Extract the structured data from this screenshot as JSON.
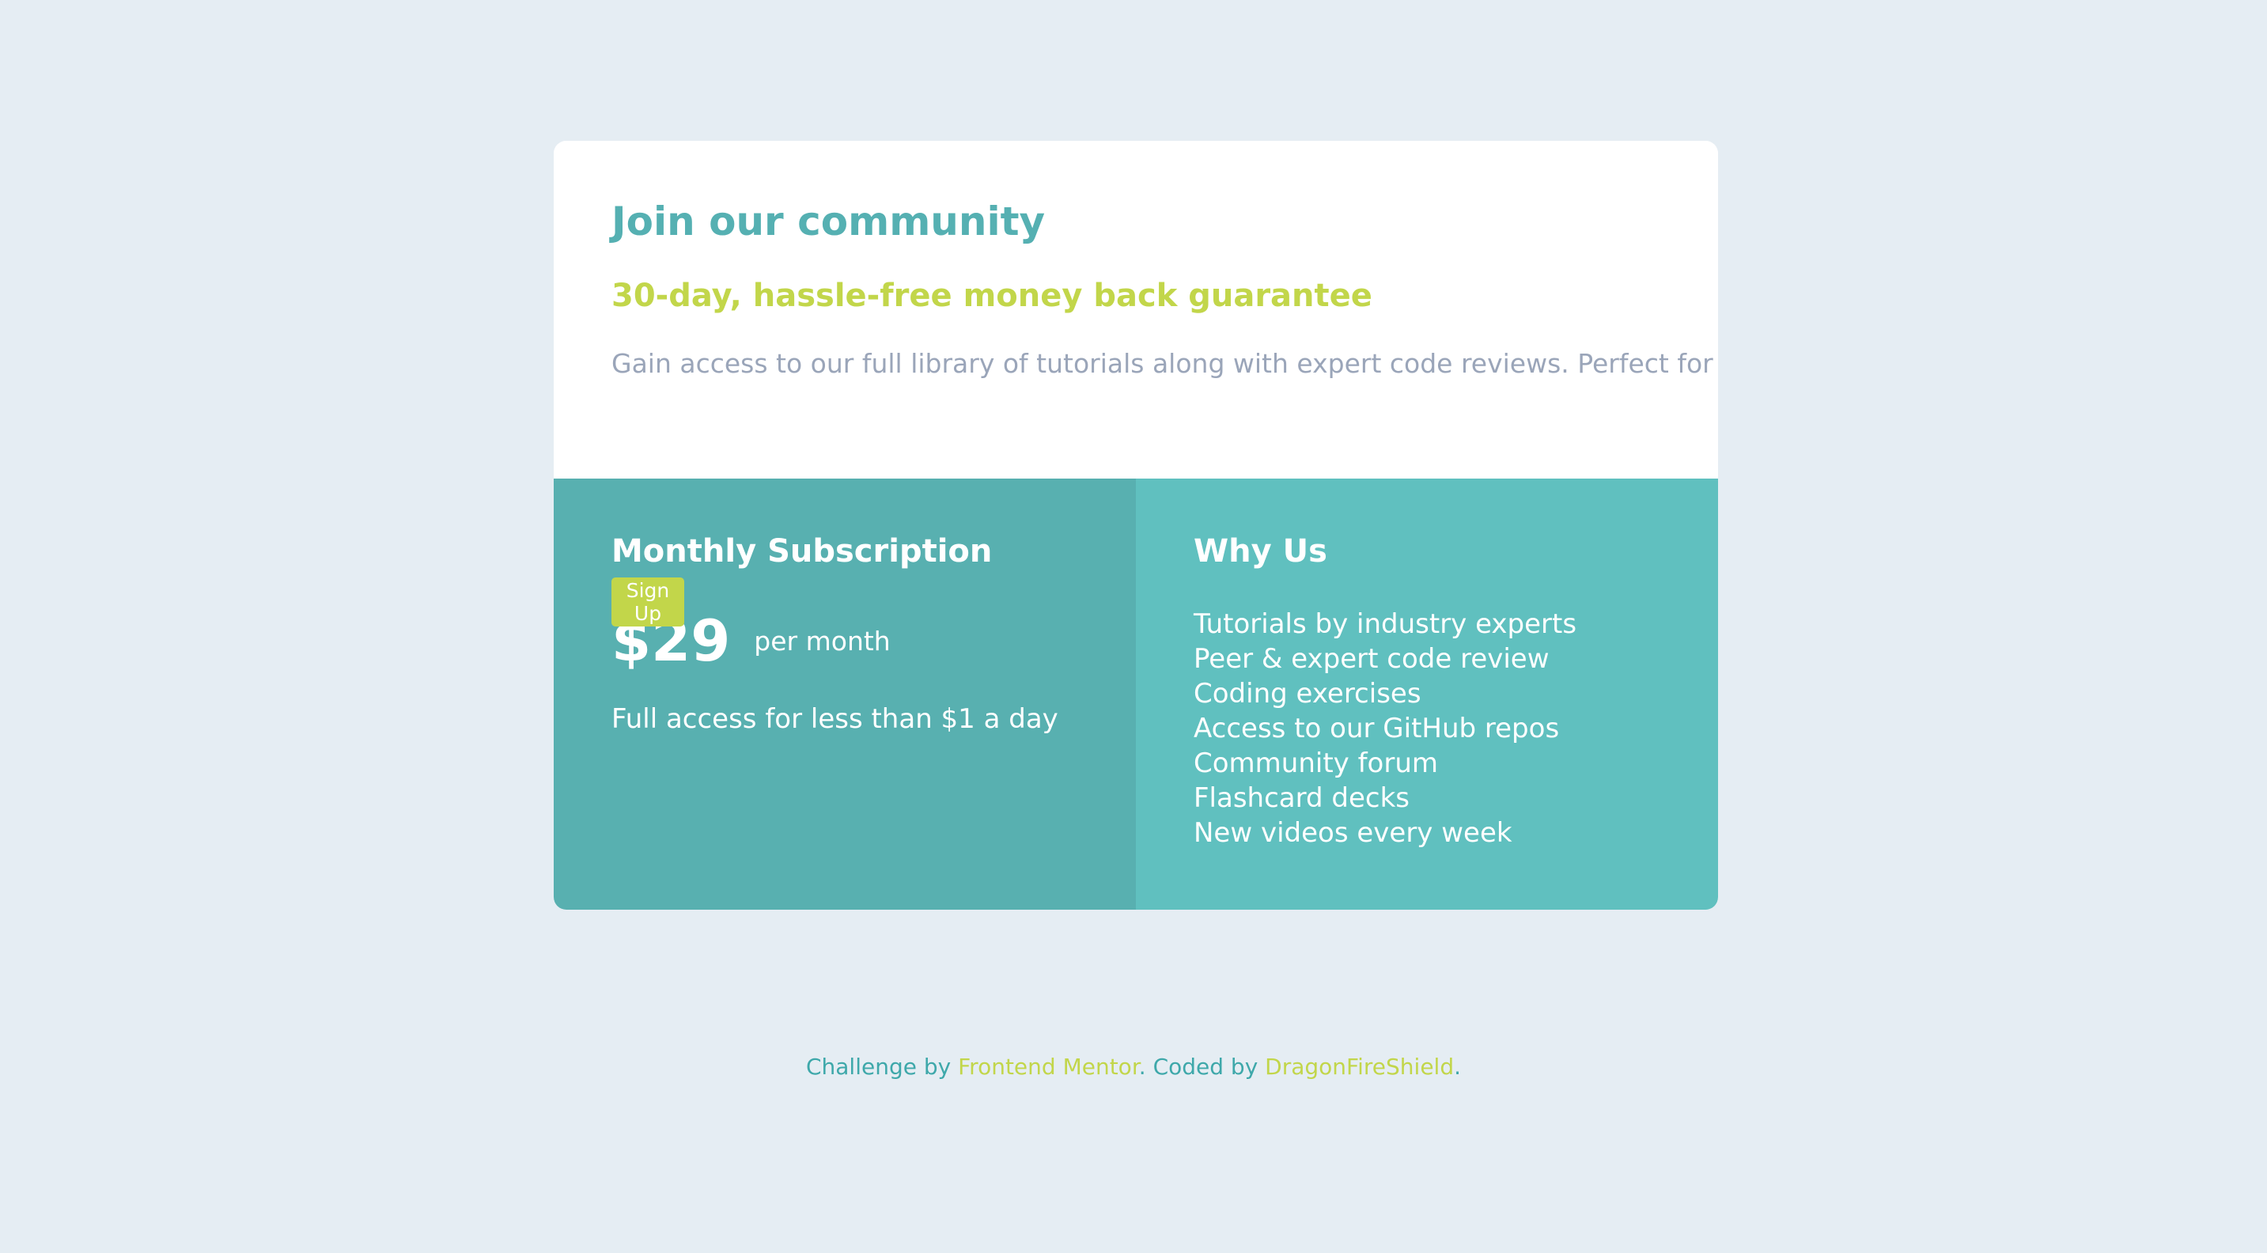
{
  "card": {
    "title": "Join our community",
    "guarantee": "30-day, hassle-free money back guarantee",
    "description": "Gain access to our full library of tutorials along with expert code reviews. Perfect for any developers who are serious about honing their skills."
  },
  "monthly": {
    "heading": "Monthly Subscription",
    "price": "$29",
    "period": "per month",
    "access": "Full access for less than $1 a day",
    "signup": "Sign Up"
  },
  "why": {
    "heading": "Why Us",
    "items": [
      "Tutorials by industry experts",
      "Peer & expert code review",
      "Coding exercises",
      "Access to our GitHub repos",
      "Community forum",
      "Flashcard decks",
      "New videos every week"
    ]
  },
  "footer": {
    "prefix": "Challenge by",
    "challenge_link": "Frontend Mentor",
    "coded_by": ". Coded by",
    "author_link": "DragonFireShield",
    "suffix": "."
  },
  "colors": {
    "page_background": "#e5edf3",
    "card_background": "#ffffff",
    "heading_teal": "#55b0b2",
    "accent_yellow": "#c2d64a",
    "muted_text": "#9aa5b9",
    "monthly_panel": "#58b0b0",
    "why_panel": "#60c0bf",
    "footer_text": "#3ea8aa"
  }
}
